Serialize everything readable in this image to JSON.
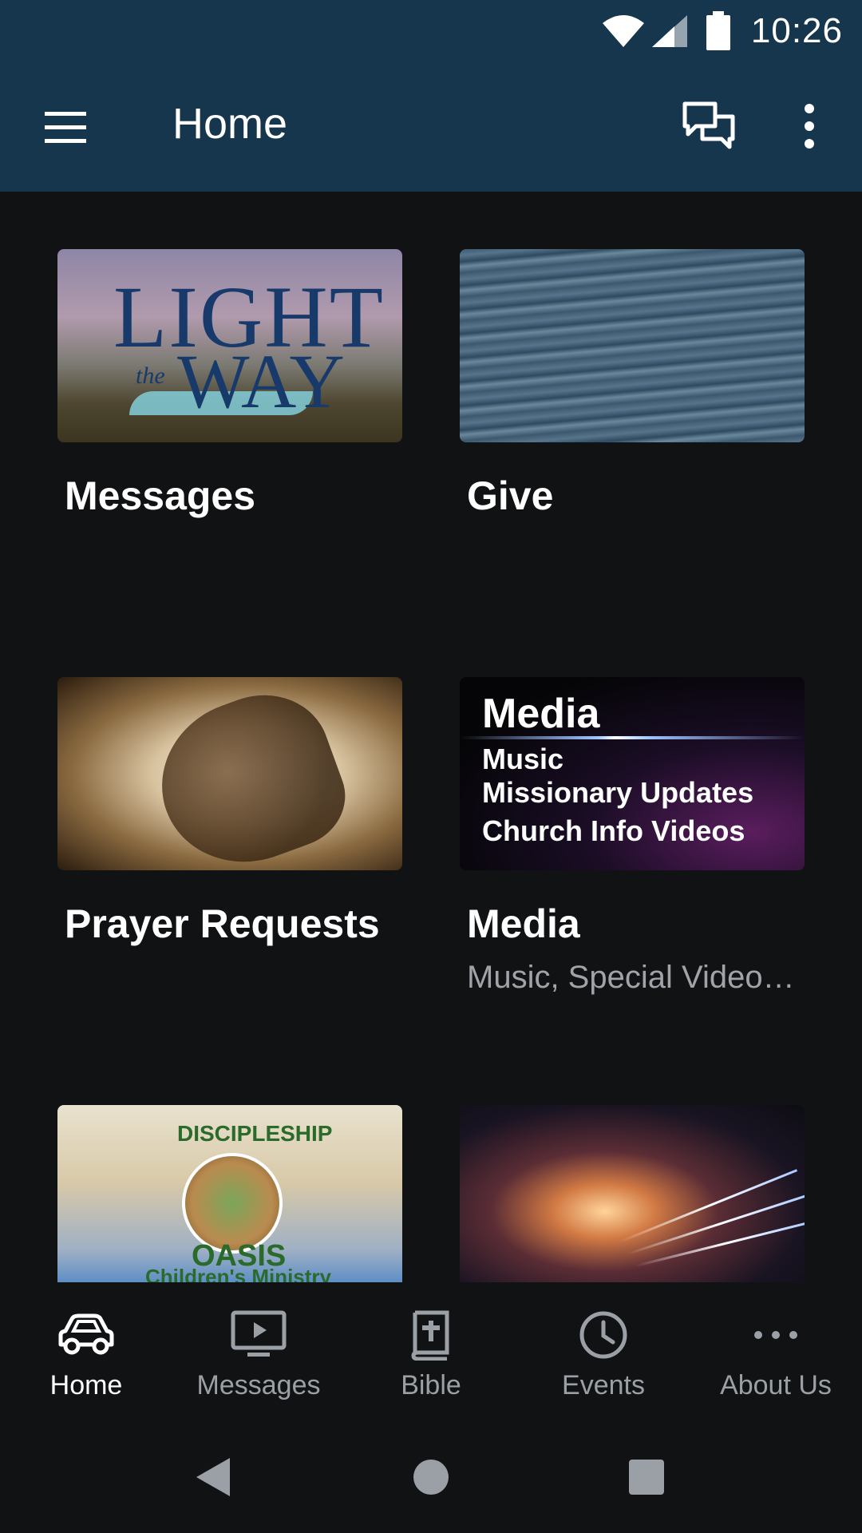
{
  "status_bar": {
    "time": "10:26"
  },
  "app_bar": {
    "title": "Home",
    "icons": [
      "menu-icon",
      "chat-icon",
      "more-vert-icon"
    ]
  },
  "cards": [
    {
      "title": "Messages",
      "subtitle": "",
      "thumbnail": {
        "lines": [
          "LIGHT",
          "WAY",
          "the"
        ]
      }
    },
    {
      "title": "Give",
      "subtitle": ""
    },
    {
      "title": "Prayer Requests",
      "subtitle": ""
    },
    {
      "title": "Media",
      "subtitle": "Music, Special Video…",
      "thumbnail": {
        "title": "Media",
        "lines": [
          "Music",
          "Missionary Updates",
          "Church Info Videos"
        ]
      }
    },
    {
      "title": "",
      "subtitle": "",
      "thumbnail": {
        "top": "DISCIPLESHIP",
        "mid": "OASIS",
        "bottom": "Children's Ministry"
      }
    },
    {
      "title": "",
      "subtitle": ""
    }
  ],
  "bottom_nav": [
    {
      "label": "Home",
      "icon": "car-icon",
      "active": true
    },
    {
      "label": "Messages",
      "icon": "tv-play-icon",
      "active": false
    },
    {
      "label": "Bible",
      "icon": "bible-icon",
      "active": false
    },
    {
      "label": "Events",
      "icon": "clock-icon",
      "active": false
    },
    {
      "label": "About Us",
      "icon": "dots-horizontal-icon",
      "active": false
    }
  ],
  "system_nav": [
    "back-icon",
    "home-circle-icon",
    "recents-square-icon"
  ],
  "colors": {
    "app_bar": "#15364d",
    "background": "#111214",
    "inactive": "#9aa0a6"
  }
}
